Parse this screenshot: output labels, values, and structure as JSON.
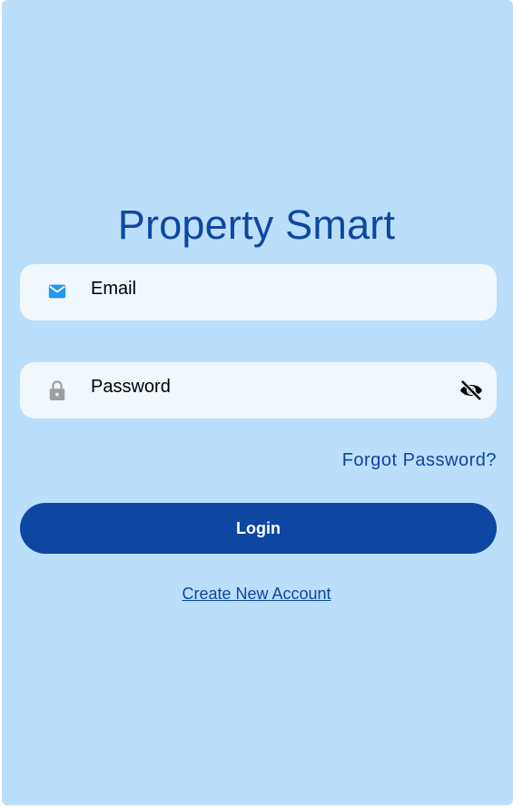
{
  "app": {
    "title": "Property Smart"
  },
  "form": {
    "email": {
      "label": "Email",
      "icon": "mail-icon"
    },
    "password": {
      "label": "Password",
      "icon": "lock-icon",
      "toggle_icon": "visibility-off-icon"
    },
    "forgot_password": "Forgot Password?",
    "login_label": "Login",
    "create_account": "Create New Account"
  },
  "colors": {
    "background": "#bbdefa",
    "field_background": "#f0f7fd",
    "primary": "#0d47a1",
    "mail_icon": "#2196f3",
    "lock_icon": "#9e9e9e"
  }
}
